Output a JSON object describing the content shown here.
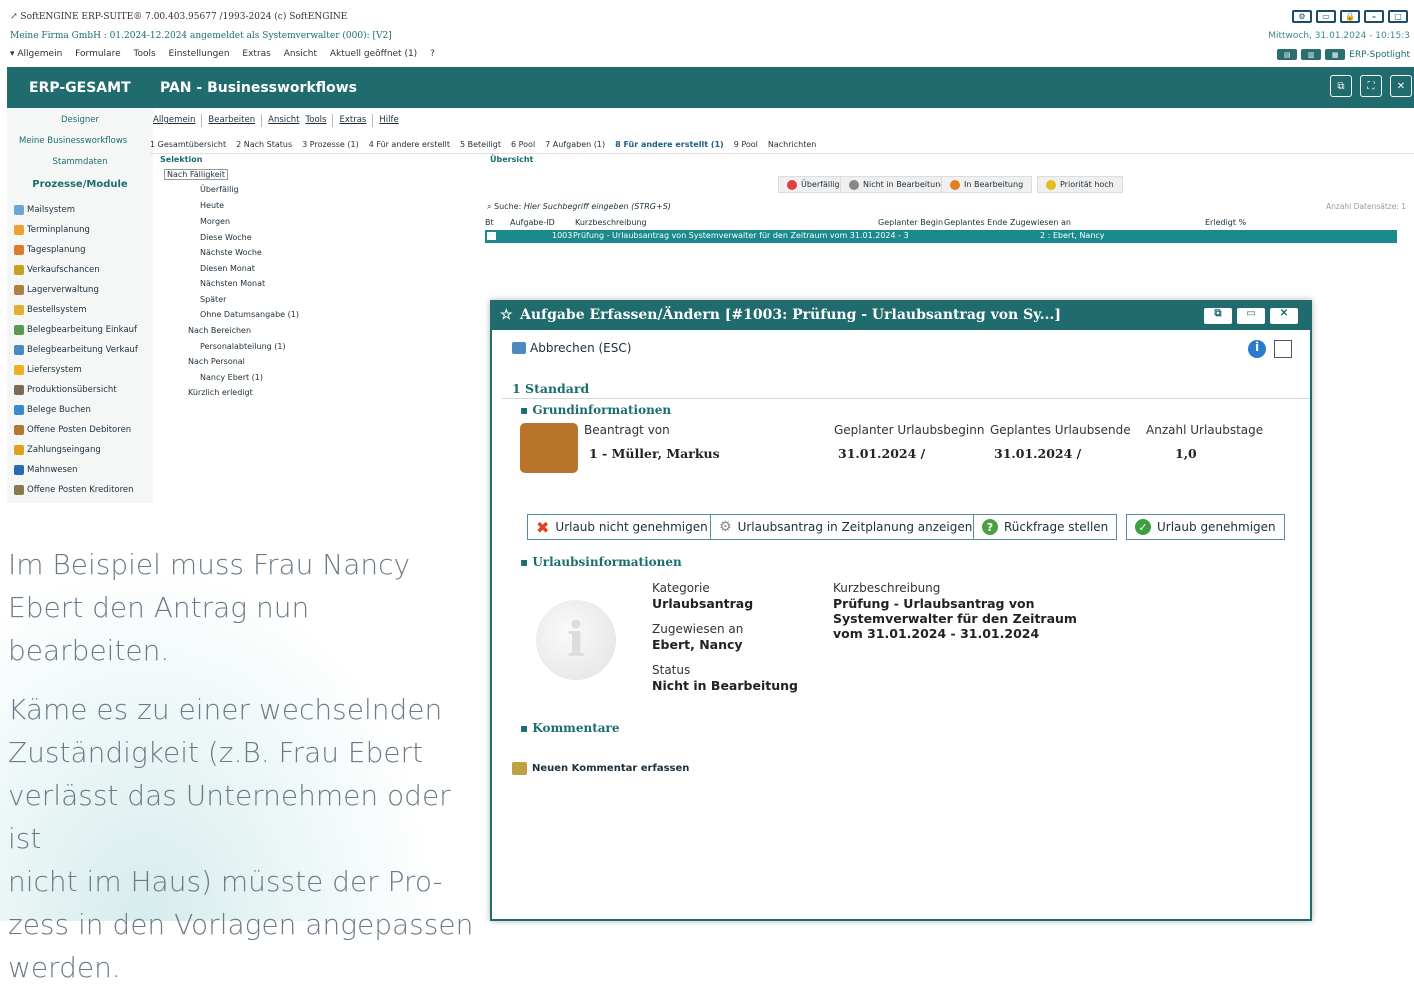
{
  "titlebar": {
    "line1": "↗ SoftENGINE ERP-SUITE® 7.00.403.95677 /1993-2024 (c) SoftENGINE",
    "line2": "Meine Firma GmbH : 01.2024-12.2024 angemeldet als Systemverwalter (000): [V2]",
    "menu": [
      "▾ Allgemein",
      "Formulare",
      "Tools",
      "Einstellungen",
      "Extras",
      "Ansicht",
      "Aktuell geöffnet (1)",
      "?"
    ],
    "datetime": "Mittwoch, 31.01.2024 - 10:15:3",
    "spotlight": "ERP-Spotlight"
  },
  "header": {
    "left": "ERP-GESAMT",
    "right": "PAN - Businessworkflows"
  },
  "sidebar": {
    "top": [
      "Designer",
      "Meine Businessworkflows",
      "Stammdaten"
    ],
    "section": "Prozesse/Module",
    "items": [
      "Mailsystem",
      "Terminplanung",
      "Tagesplanung",
      "Verkaufschancen",
      "Lagerverwaltung",
      "Bestellsystem",
      "Belegbearbeitung Einkauf",
      "Belegbearbeitung Verkauf",
      "Liefersystem",
      "Produktionsübersicht",
      "Belege Buchen",
      "Offene Posten Debitoren",
      "Zahlungseingang",
      "Mahnwesen",
      "Offene Posten Kreditoren"
    ]
  },
  "toolbar": [
    "Allgemein",
    "Bearbeiten",
    "Ansicht",
    "Tools",
    "Extras",
    "Hilfe"
  ],
  "tabs": [
    "1 Gesamtübersicht",
    "2 Nach Status",
    "3 Prozesse (1)",
    "4 Für andere erstellt",
    "5 Beteiligt",
    "6 Pool",
    "7 Aufgaben (1)",
    "8 Für andere erstellt (1)",
    "9 Pool",
    "Nachrichten"
  ],
  "tree": {
    "selektion": "Selektion",
    "nach_faelligkeit": "Nach Fälligkeit",
    "items": [
      "Überfällig",
      "Heute",
      "Morgen",
      "Diese Woche",
      "Nächste Woche",
      "Diesen Monat",
      "Nächsten Monat",
      "Später",
      "Ohne Datumsangabe (1)"
    ],
    "nach_bereichen": "Nach Bereichen",
    "personalabteilung": "Personalabteilung (1)",
    "nach_personal": "Nach Personal",
    "nancy": "Nancy Ebert (1)",
    "kuerzlich": "Kürzlich erledigt"
  },
  "overview": {
    "title": "Übersicht",
    "chips": [
      "Überfällig",
      "Nicht in Bearbeitung",
      "In Bearbeitung",
      "Priorität hoch"
    ],
    "search_label": "Suche:",
    "search_placeholder": "Hier Suchbegriff eingeben (STRG+S)",
    "count": "Anzahl Datensätze: 1",
    "columns": [
      "Bt",
      "Aufgabe-ID",
      "Kurzbeschreibung",
      "Geplanter Begin",
      "Geplantes Ende",
      "Zugewiesen an",
      "Erledigt %"
    ],
    "row": {
      "id": "1003",
      "desc": "Prüfung - Urlaubsantrag von Systemverwalter für den Zeitraum vom 31.01.2024 - 3",
      "assigned": "2 : Ebert, Nancy"
    }
  },
  "dialog": {
    "title": "Aufgabe Erfassen/Ändern [#1003: Prüfung - Urlaubsantrag von Sy...]",
    "cancel": "Abbrechen (ESC)",
    "tab": "1 Standard",
    "grund": "Grundinformationen",
    "beantragt_label": "Beantragt von",
    "beantragt_value": "1 - Müller, Markus",
    "beginn_label": "Geplanter Urlaubsbeginn",
    "beginn_value": "31.01.2024 /",
    "ende_label": "Geplantes Urlaubsende",
    "ende_value": "31.01.2024 /",
    "tage_label": "Anzahl Urlaubstage",
    "tage_value": "1,0",
    "btn_reject": "Urlaub nicht genehmigen",
    "btn_show": "Urlaubsantrag in Zeitplanung anzeigen",
    "btn_query": "Rückfrage stellen",
    "btn_approve": "Urlaub genehmigen",
    "urlaub": "Urlaubsinformationen",
    "kat_label": "Kategorie",
    "kat_value": "Urlaubsantrag",
    "zug_label": "Zugewiesen an",
    "zug_value": "Ebert, Nancy",
    "status_label": "Status",
    "status_value": "Nicht in Bearbeitung",
    "kurz_label": "Kurzbeschreibung",
    "kurz_value1": "Prüfung - Urlaubsantrag von",
    "kurz_value2": "Systemverwalter für den Zeitraum",
    "kurz_value3": "vom 31.01.2024 - 31.01.2024",
    "kommentare": "Kommentare",
    "neuer_kommentar": "Neuen Kommentar erfassen"
  },
  "caption": {
    "p1a": "Im Beispiel muss Frau Nancy",
    "p1b": "Ebert den Antrag nun bearbeiten.",
    "p2a": "Käme es zu einer wechselnden",
    "p2b": "Zuständigkeit (z.B. Frau Ebert",
    "p2c": "verlässt das Unternehmen oder ist",
    "p2d": "nicht im Haus) müsste der Pro-",
    "p2e": "zess in den Vorlagen angepassen",
    "p2f": "werden."
  }
}
